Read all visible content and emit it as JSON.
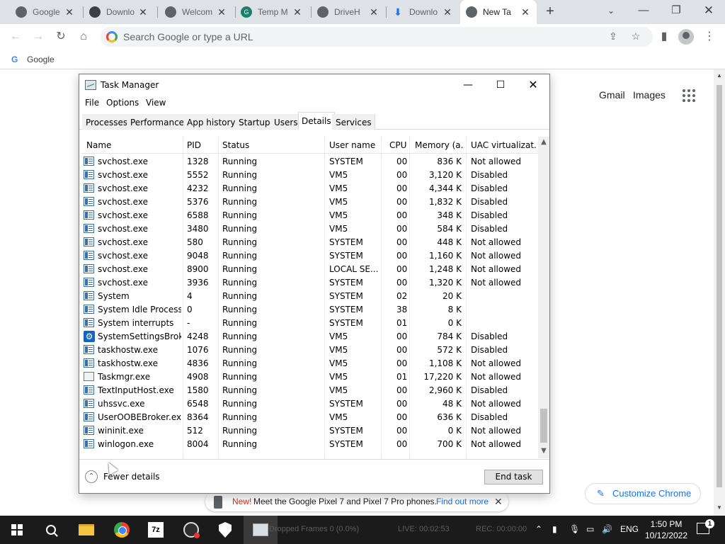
{
  "browser": {
    "tabs": [
      {
        "title": "Google",
        "active": false
      },
      {
        "title": "Downlo",
        "active": false
      },
      {
        "title": "Welcom",
        "active": false
      },
      {
        "title": "Temp M",
        "active": false
      },
      {
        "title": "DriveH",
        "active": false
      },
      {
        "title": "Downlo",
        "active": false
      },
      {
        "title": "New Ta",
        "active": true
      }
    ],
    "omnibox_placeholder": "Search Google or type a URL",
    "bookmark_label": "Google"
  },
  "ntp": {
    "gmail_label": "Gmail",
    "images_label": "Images",
    "customize_label": "Customize Chrome",
    "promo": {
      "new_label": "New!",
      "message": "Meet the Google Pixel 7 and Pixel 7 Pro phones.",
      "link": "Find out more"
    }
  },
  "task_manager": {
    "title": "Task Manager",
    "menu": [
      "File",
      "Options",
      "View"
    ],
    "tabs": [
      "Processes",
      "Performance",
      "App history",
      "Startup",
      "Users",
      "Details",
      "Services"
    ],
    "active_tab": "Details",
    "columns": [
      "Name",
      "PID",
      "Status",
      "User name",
      "CPU",
      "Memory (a...",
      "UAC virtualizat..."
    ],
    "rows": [
      {
        "name": "svchost.exe",
        "pid": "1328",
        "status": "Running",
        "user": "SYSTEM",
        "cpu": "00",
        "memory": "836 K",
        "uac": "Not allowed",
        "icon": "service"
      },
      {
        "name": "svchost.exe",
        "pid": "5552",
        "status": "Running",
        "user": "VM5",
        "cpu": "00",
        "memory": "3,120 K",
        "uac": "Disabled",
        "icon": "service"
      },
      {
        "name": "svchost.exe",
        "pid": "4232",
        "status": "Running",
        "user": "VM5",
        "cpu": "00",
        "memory": "4,344 K",
        "uac": "Disabled",
        "icon": "service"
      },
      {
        "name": "svchost.exe",
        "pid": "5376",
        "status": "Running",
        "user": "VM5",
        "cpu": "00",
        "memory": "1,832 K",
        "uac": "Disabled",
        "icon": "service"
      },
      {
        "name": "svchost.exe",
        "pid": "6588",
        "status": "Running",
        "user": "VM5",
        "cpu": "00",
        "memory": "348 K",
        "uac": "Disabled",
        "icon": "service"
      },
      {
        "name": "svchost.exe",
        "pid": "3480",
        "status": "Running",
        "user": "VM5",
        "cpu": "00",
        "memory": "584 K",
        "uac": "Disabled",
        "icon": "service"
      },
      {
        "name": "svchost.exe",
        "pid": "580",
        "status": "Running",
        "user": "SYSTEM",
        "cpu": "00",
        "memory": "448 K",
        "uac": "Not allowed",
        "icon": "service"
      },
      {
        "name": "svchost.exe",
        "pid": "9048",
        "status": "Running",
        "user": "SYSTEM",
        "cpu": "00",
        "memory": "1,160 K",
        "uac": "Not allowed",
        "icon": "service"
      },
      {
        "name": "svchost.exe",
        "pid": "8900",
        "status": "Running",
        "user": "LOCAL SE...",
        "cpu": "00",
        "memory": "1,248 K",
        "uac": "Not allowed",
        "icon": "service"
      },
      {
        "name": "svchost.exe",
        "pid": "3936",
        "status": "Running",
        "user": "SYSTEM",
        "cpu": "00",
        "memory": "1,320 K",
        "uac": "Not allowed",
        "icon": "service"
      },
      {
        "name": "System",
        "pid": "4",
        "status": "Running",
        "user": "SYSTEM",
        "cpu": "02",
        "memory": "20 K",
        "uac": "",
        "icon": "service"
      },
      {
        "name": "System Idle Process",
        "pid": "0",
        "status": "Running",
        "user": "SYSTEM",
        "cpu": "38",
        "memory": "8 K",
        "uac": "",
        "icon": "service"
      },
      {
        "name": "System interrupts",
        "pid": "-",
        "status": "Running",
        "user": "SYSTEM",
        "cpu": "01",
        "memory": "0 K",
        "uac": "",
        "icon": "service"
      },
      {
        "name": "SystemSettingsBroke...",
        "pid": "4248",
        "status": "Running",
        "user": "VM5",
        "cpu": "00",
        "memory": "784 K",
        "uac": "Disabled",
        "icon": "gear"
      },
      {
        "name": "taskhostw.exe",
        "pid": "1076",
        "status": "Running",
        "user": "VM5",
        "cpu": "00",
        "memory": "572 K",
        "uac": "Disabled",
        "icon": "service"
      },
      {
        "name": "taskhostw.exe",
        "pid": "4836",
        "status": "Running",
        "user": "VM5",
        "cpu": "00",
        "memory": "1,108 K",
        "uac": "Not allowed",
        "icon": "service"
      },
      {
        "name": "Taskmgr.exe",
        "pid": "4908",
        "status": "Running",
        "user": "VM5",
        "cpu": "01",
        "memory": "17,220 K",
        "uac": "Not allowed",
        "icon": "chart"
      },
      {
        "name": "TextInputHost.exe",
        "pid": "1580",
        "status": "Running",
        "user": "VM5",
        "cpu": "00",
        "memory": "2,960 K",
        "uac": "Disabled",
        "icon": "service"
      },
      {
        "name": "uhssvc.exe",
        "pid": "6548",
        "status": "Running",
        "user": "SYSTEM",
        "cpu": "00",
        "memory": "48 K",
        "uac": "Not allowed",
        "icon": "service"
      },
      {
        "name": "UserOOBEBroker.exe",
        "pid": "8364",
        "status": "Running",
        "user": "VM5",
        "cpu": "00",
        "memory": "636 K",
        "uac": "Disabled",
        "icon": "service"
      },
      {
        "name": "wininit.exe",
        "pid": "512",
        "status": "Running",
        "user": "SYSTEM",
        "cpu": "00",
        "memory": "0 K",
        "uac": "Not allowed",
        "icon": "service"
      },
      {
        "name": "winlogon.exe",
        "pid": "8004",
        "status": "Running",
        "user": "SYSTEM",
        "cpu": "00",
        "memory": "700 K",
        "uac": "Not allowed",
        "icon": "service"
      }
    ],
    "fewer_details_label": "Fewer details",
    "end_task_label": "End task"
  },
  "taskbar": {
    "obs_dropped_frames": "Dropped Frames 0 (0.0%)",
    "obs_live": "LIVE: 00:02:53",
    "obs_rec": "REC: 00:00:00",
    "language": "ENG",
    "time": "1:50 PM",
    "date": "10/12/2022",
    "notification_count": "1"
  }
}
